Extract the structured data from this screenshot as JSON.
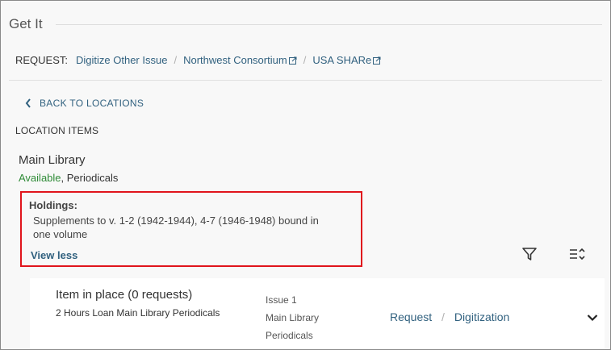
{
  "section": {
    "title": "Get It"
  },
  "request": {
    "label": "REQUEST:",
    "links": [
      {
        "label": "Digitize Other Issue",
        "external": false
      },
      {
        "label": "Northwest Consortium",
        "external": true
      },
      {
        "label": "USA SHARe",
        "external": true
      }
    ]
  },
  "back": {
    "label": "BACK TO LOCATIONS"
  },
  "location_items": {
    "title": "LOCATION ITEMS"
  },
  "location": {
    "name": "Main Library",
    "availability": "Available",
    "collection": ", Periodicals"
  },
  "holdings": {
    "label": "Holdings:",
    "text": "Supplements to v. 1-2 (1942-1944), 4-7 (1946-1948) bound in one volume",
    "toggle_label": "View less"
  },
  "tools": {
    "filter_icon": "filter-icon",
    "sort_icon": "sort-icon"
  },
  "item": {
    "title": "Item in place (0 requests)",
    "policy": "2 Hours Loan Main Library Periodicals",
    "issue": "Issue 1",
    "library": "Main Library",
    "collection": "Periodicals",
    "actions": {
      "request": "Request",
      "digitization": "Digitization"
    }
  },
  "colors": {
    "link": "#31617f",
    "available": "#2f8b37",
    "highlight_border": "#e0141c"
  }
}
